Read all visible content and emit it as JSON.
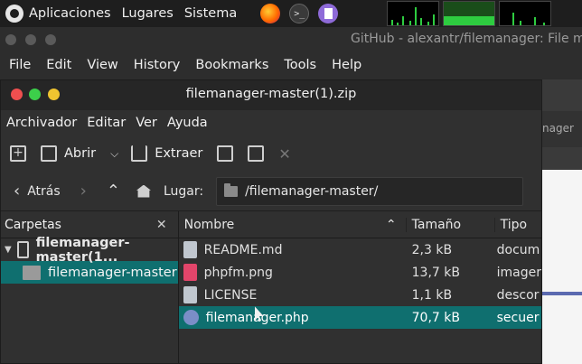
{
  "panel": {
    "menu": [
      "Aplicaciones",
      "Lugares",
      "Sistema"
    ],
    "launchers": [
      "firefox-icon",
      "terminal-icon",
      "text-editor-icon"
    ]
  },
  "browser": {
    "title": "GitHub - alexantr/filemanager: File mana",
    "menu": [
      "File",
      "Edit",
      "View",
      "History",
      "Bookmarks",
      "Tools",
      "Help"
    ],
    "tab_partial": "nager"
  },
  "archive": {
    "title": "filemanager-master(1).zip",
    "menu": [
      "Archivador",
      "Editar",
      "Ver",
      "Ayuda"
    ],
    "toolbar": {
      "open": "Abrir",
      "extract": "Extraer"
    },
    "location": {
      "back": "Atrás",
      "label": "Lugar:",
      "path": "/filemanager-master/"
    },
    "sidebar": {
      "title": "Carpetas",
      "archive": "filemanager-master(1...",
      "folder": "filemanager-master"
    },
    "columns": {
      "name": "Nombre",
      "size": "Tamaño",
      "type": "Tipo"
    },
    "files": [
      {
        "name": "README.md",
        "size": "2,3 kB",
        "type": "docum",
        "icon": "document-icon"
      },
      {
        "name": "phpfm.png",
        "size": "13,7 kB",
        "type": "imager",
        "icon": "image-icon"
      },
      {
        "name": "LICENSE",
        "size": "1,1 kB",
        "type": "descor",
        "icon": "license-icon"
      },
      {
        "name": "filemanager.php",
        "size": "70,7 kB",
        "type": "secuer",
        "icon": "php-icon",
        "selected": true
      }
    ]
  },
  "colors": {
    "selection": "#0f6f6f",
    "close_red": "#ee4f4f",
    "maximize_green": "#3ccf4a",
    "minimize_yellow": "#f0c430"
  }
}
